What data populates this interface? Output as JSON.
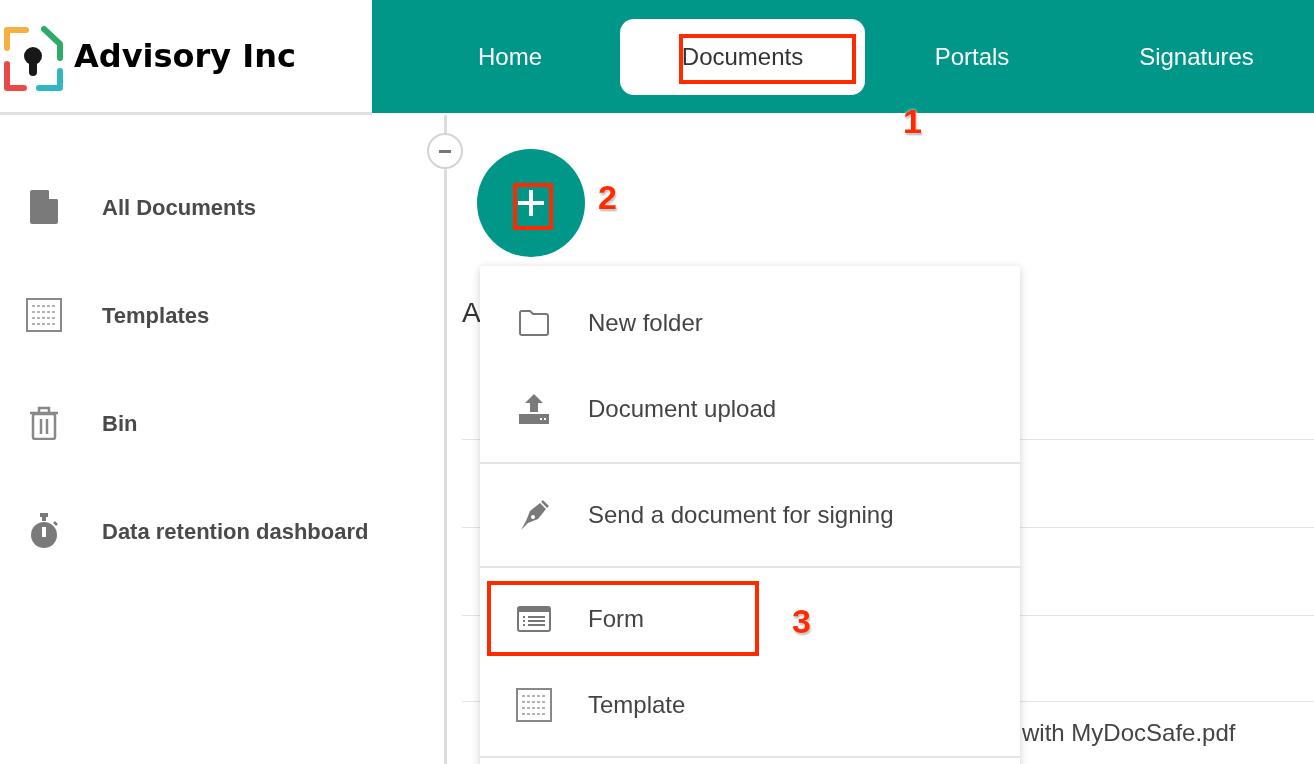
{
  "brand": {
    "name": "Advisory Inc"
  },
  "tabs": [
    {
      "label": "Home",
      "selected": false
    },
    {
      "label": "Documents",
      "selected": true
    },
    {
      "label": "Portals",
      "selected": false
    },
    {
      "label": "Signatures",
      "selected": false
    }
  ],
  "sidebar": {
    "items": [
      {
        "label": "All Documents"
      },
      {
        "label": "Templates"
      },
      {
        "label": "Bin"
      },
      {
        "label": "Data retention dashboard"
      }
    ]
  },
  "content": {
    "heading": "A",
    "row_text": "with MyDocSafe.pdf"
  },
  "menu": {
    "sections": [
      [
        {
          "label": "New folder"
        },
        {
          "label": "Document upload"
        }
      ],
      [
        {
          "label": "Send a document for signing"
        }
      ],
      [
        {
          "label": "Form"
        },
        {
          "label": "Template"
        }
      ]
    ]
  },
  "annotations": [
    {
      "label": "1"
    },
    {
      "label": "2"
    },
    {
      "label": "3"
    }
  ]
}
